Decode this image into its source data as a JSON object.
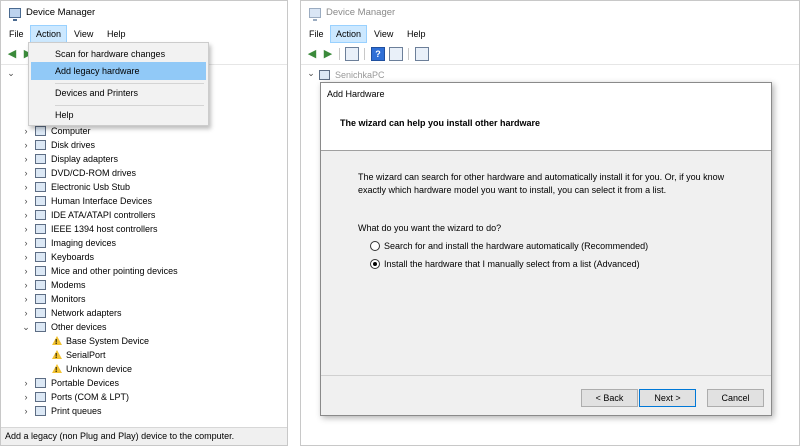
{
  "left_window": {
    "title": "Device Manager",
    "menu": [
      "File",
      "Action",
      "View",
      "Help"
    ],
    "dropdown": [
      "Scan for hardware changes",
      "Add legacy hardware",
      "Devices and Printers",
      "Help"
    ],
    "tree": [
      {
        "label": "Computer",
        "type": "category",
        "expanded": false
      },
      {
        "label": "Disk drives",
        "type": "category",
        "expanded": false
      },
      {
        "label": "Display adapters",
        "type": "category",
        "expanded": false
      },
      {
        "label": "DVD/CD-ROM drives",
        "type": "category",
        "expanded": false
      },
      {
        "label": "Electronic Usb Stub",
        "type": "category",
        "expanded": false
      },
      {
        "label": "Human Interface Devices",
        "type": "category",
        "expanded": false
      },
      {
        "label": "IDE ATA/ATAPI controllers",
        "type": "category",
        "expanded": false
      },
      {
        "label": "IEEE 1394 host controllers",
        "type": "category",
        "expanded": false
      },
      {
        "label": "Imaging devices",
        "type": "category",
        "expanded": false
      },
      {
        "label": "Keyboards",
        "type": "category",
        "expanded": false
      },
      {
        "label": "Mice and other pointing devices",
        "type": "category",
        "expanded": false
      },
      {
        "label": "Modems",
        "type": "category",
        "expanded": false
      },
      {
        "label": "Monitors",
        "type": "category",
        "expanded": false
      },
      {
        "label": "Network adapters",
        "type": "category",
        "expanded": false
      },
      {
        "label": "Other devices",
        "type": "category",
        "expanded": true
      },
      {
        "label": "Base System Device",
        "type": "warning-device"
      },
      {
        "label": "SerialPort",
        "type": "warning-device"
      },
      {
        "label": "Unknown device",
        "type": "warning-device"
      },
      {
        "label": "Portable Devices",
        "type": "category",
        "expanded": false
      },
      {
        "label": "Ports (COM & LPT)",
        "type": "category",
        "expanded": false
      },
      {
        "label": "Print queues",
        "type": "category",
        "expanded": false
      }
    ],
    "status": "Add a legacy (non Plug and Play) device to the computer."
  },
  "right_window": {
    "title": "Device Manager",
    "menu": [
      "File",
      "Action",
      "View",
      "Help"
    ],
    "root_node": "SenichkaPC"
  },
  "dialog": {
    "title": "Add Hardware",
    "heading": "The wizard can help you install other hardware",
    "description": "The wizard can search for other hardware and automatically install it for you. Or, if you know exactly which hardware model you want to install, you can select it from a list.",
    "question": "What do you want the wizard to do?",
    "options": [
      {
        "label": "Search for and install the hardware automatically (Recommended)",
        "selected": false
      },
      {
        "label": "Install the hardware that I manually select from a list (Advanced)",
        "selected": true
      }
    ],
    "buttons": {
      "back": "< Back",
      "next": "Next >",
      "cancel": "Cancel"
    }
  },
  "colors": {
    "menu_highlight": "#91c9f7",
    "warning": "#f2c230",
    "default_button_border": "#0078d7"
  }
}
